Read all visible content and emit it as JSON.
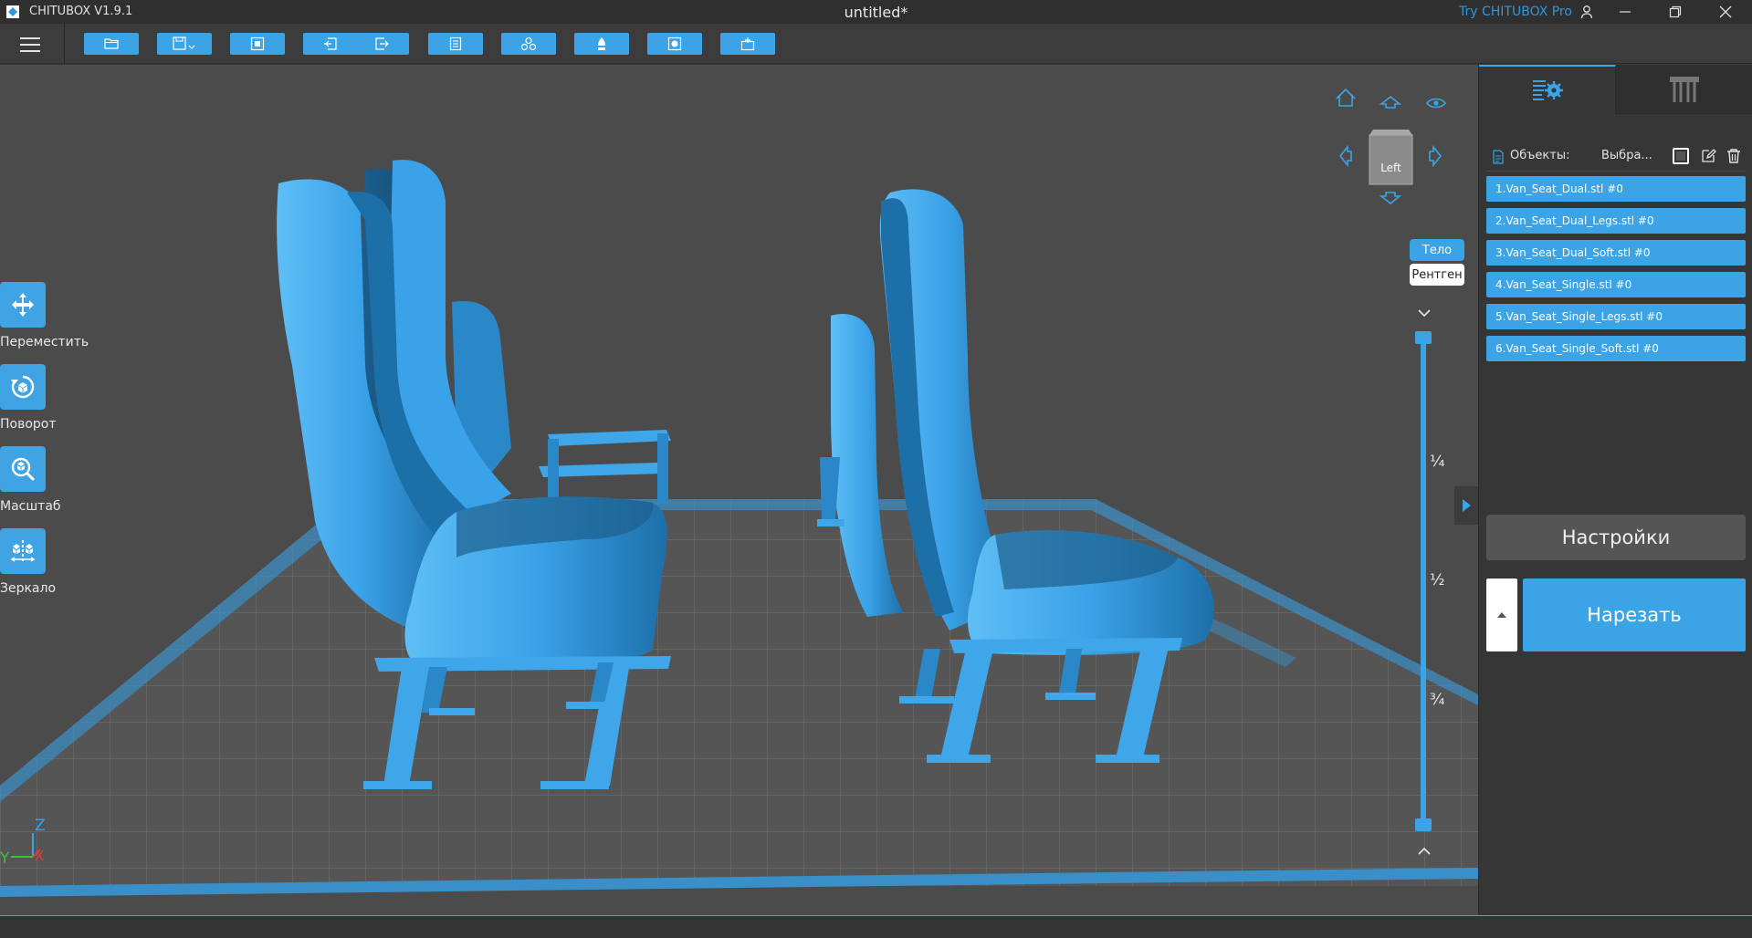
{
  "window": {
    "app_name": "CHITUBOX V1.9.1",
    "document_title": "untitled*",
    "try_pro": "Try CHITUBOX Pro"
  },
  "toolbar": {
    "buttons": [
      "open-file",
      "save",
      "auto-layout",
      "import",
      "export",
      "file-info",
      "duplicate",
      "support",
      "hollow",
      "add-base"
    ]
  },
  "left_tools": [
    {
      "label": "Переместить",
      "icon": "move-icon"
    },
    {
      "label": "Поворот",
      "icon": "rotate-icon"
    },
    {
      "label": "Масштаб",
      "icon": "scale-icon"
    },
    {
      "label": "Зеркало",
      "icon": "mirror-icon"
    }
  ],
  "view_cube": {
    "face_label": "Left"
  },
  "view_modes": {
    "body": "Тело",
    "xray": "Рентген"
  },
  "layer_slider": {
    "marks": [
      "¼",
      "½",
      "¾"
    ]
  },
  "axis_gizmo": {
    "z": "Z",
    "y": "Y",
    "x": "X"
  },
  "panel": {
    "objects_label": "Объекты:",
    "select_label": "Выбра...",
    "objects": [
      "1.Van_Seat_Dual.stl #0",
      "2.Van_Seat_Dual_Legs.stl #0",
      "3.Van_Seat_Dual_Soft.stl #0",
      "4.Van_Seat_Single.stl #0",
      "5.Van_Seat_Single_Legs.stl #0",
      "6.Van_Seat_Single_Soft.stl #0"
    ],
    "settings_label": "Настройки",
    "slice_label": "Нарезать"
  },
  "colors": {
    "accent": "#3ba4e6",
    "model": "#3fa6ea",
    "model_shadow": "#1d5f8c",
    "viewport_bg": "#4b4b4b",
    "panel_bg": "#363636"
  }
}
